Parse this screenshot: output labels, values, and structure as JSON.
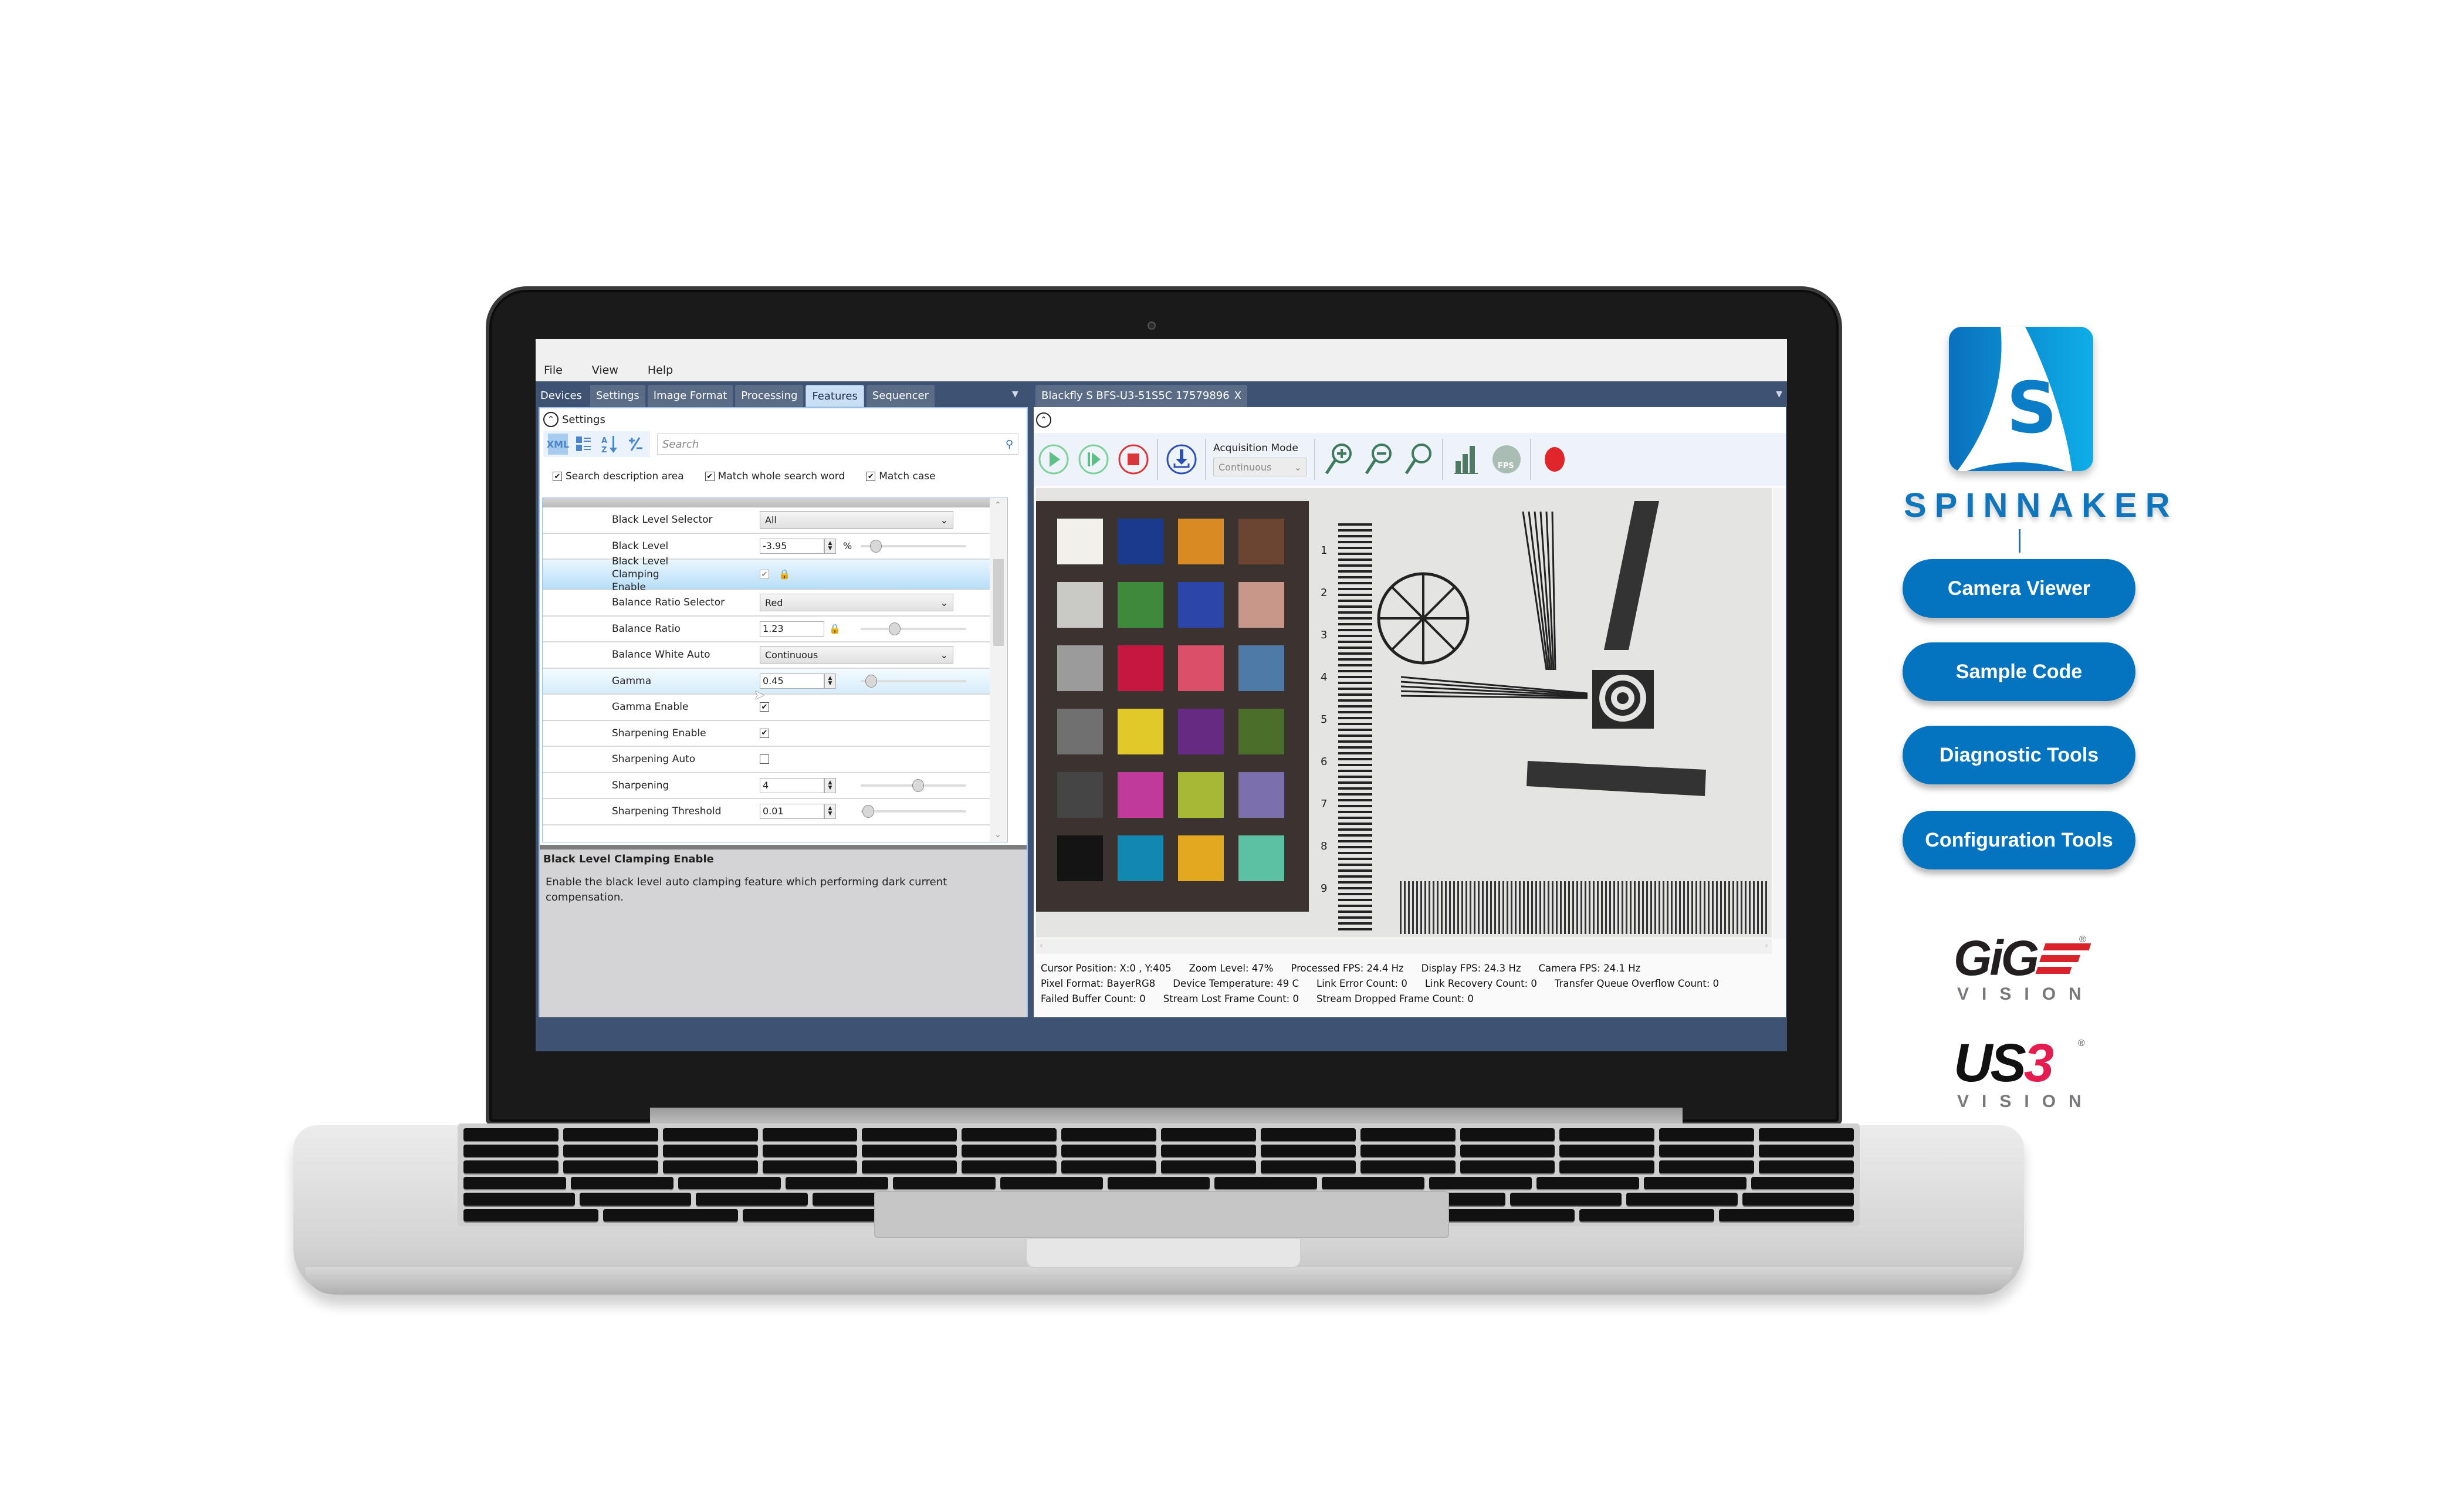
{
  "app": {
    "menu": [
      "File",
      "View",
      "Help"
    ],
    "left_tabs": [
      {
        "label": "Devices",
        "active": false
      },
      {
        "label": "Settings",
        "active": false
      },
      {
        "label": "Image Format",
        "active": false
      },
      {
        "label": "Processing",
        "active": false
      },
      {
        "label": "Features",
        "active": true
      },
      {
        "label": "Sequencer",
        "active": false
      }
    ],
    "overflow_glyph": "▼",
    "camera_tab": {
      "label": "Blackfly S BFS-U3-51S5C 17579896",
      "close": "X"
    }
  },
  "features_panel": {
    "section_title": "Settings",
    "toolbar": {
      "xml_label": "XML",
      "search_placeholder": "Search"
    },
    "options": [
      {
        "label": "Search description area",
        "checked": true
      },
      {
        "label": "Match whole search word",
        "checked": true
      },
      {
        "label": "Match case",
        "checked": true
      }
    ],
    "rows": [
      {
        "name": "Black Level Selector",
        "type": "dropdown",
        "value": "All"
      },
      {
        "name": "Black Level",
        "type": "number",
        "value": "-3.95",
        "unit": "%",
        "slider": 0.1
      },
      {
        "name": "Black Level Clamping Enable",
        "type": "checkbox",
        "checked": true,
        "locked": true,
        "selected": true
      },
      {
        "name": "Balance Ratio Selector",
        "type": "dropdown",
        "value": "Red"
      },
      {
        "name": "Balance Ratio",
        "type": "text",
        "value": "1.23",
        "locked": true,
        "slider": 0.3
      },
      {
        "name": "Balance White Auto",
        "type": "dropdown",
        "value": "Continuous"
      },
      {
        "name": "Gamma",
        "type": "number",
        "value": "0.45",
        "slider": 0.05,
        "highlight": true
      },
      {
        "name": "Gamma Enable",
        "type": "checkbox",
        "checked": true
      },
      {
        "name": "Sharpening Enable",
        "type": "checkbox",
        "checked": true
      },
      {
        "name": "Sharpening Auto",
        "type": "checkbox",
        "checked": false
      },
      {
        "name": "Sharpening",
        "type": "number",
        "value": "4",
        "slider": 0.55
      },
      {
        "name": "Sharpening Threshold",
        "type": "number",
        "value": "0.01",
        "slider": 0.02
      }
    ],
    "description": {
      "title": "Black Level Clamping Enable",
      "text": "Enable the black level auto clamping feature which performing dark current compensation."
    }
  },
  "viewer": {
    "toolbar": {
      "acquisition_mode_label": "Acquisition Mode",
      "acquisition_mode_value": "Continuous",
      "buttons": [
        "play-icon",
        "play-single-icon",
        "stop-icon",
        "save-download-icon",
        "zoom-in-icon",
        "zoom-out-icon",
        "zoom-fit-icon",
        "histogram-icon",
        "fps-icon",
        "record-icon"
      ]
    },
    "status": {
      "line1": [
        "Cursor Position: X:0 , Y:405",
        "Zoom Level: 47%",
        "Processed FPS: 24.4 Hz",
        "Display FPS: 24.3 Hz",
        "Camera FPS: 24.1 Hz"
      ],
      "line2": [
        "Pixel Format: BayerRG8",
        "Device Temperature: 49 C",
        "Link Error Count: 0",
        "Link Recovery Count: 0",
        "Transfer Queue Overflow Count: 0"
      ],
      "line3": [
        "Failed Buffer Count: 0",
        "Stream Lost Frame Count: 0",
        "Stream Dropped Frame Count: 0"
      ]
    },
    "color_checker": [
      [
        "#f2f0ea",
        "#1a3a8e",
        "#d98a22",
        "#6b4532"
      ],
      [
        "#c9c9c6",
        "#3d8a3c",
        "#2c45a8",
        "#c9978a"
      ],
      [
        "#9b9b9b",
        "#c5173f",
        "#d95068",
        "#4e7aa8"
      ],
      [
        "#707070",
        "#e0c928",
        "#652a82",
        "#4b6e2a"
      ],
      [
        "#454545",
        "#c03a9c",
        "#a6b835",
        "#7b6fae"
      ],
      [
        "#141414",
        "#1287b0",
        "#e2a820",
        "#5cc0a2"
      ]
    ]
  },
  "branding": {
    "product_name": "SPINNAKER",
    "logo_letter": "S",
    "buttons": [
      "Camera Viewer",
      "Sample Code",
      "Diagnostic Tools",
      "Configuration Tools"
    ],
    "accent": "#0574c0",
    "standards": [
      {
        "name": "GiGE",
        "sub": "VISION",
        "mark": "®"
      },
      {
        "name": "US3",
        "prefix": "US",
        "suffix": "3",
        "sub": "VISION",
        "mark": "®"
      }
    ]
  }
}
